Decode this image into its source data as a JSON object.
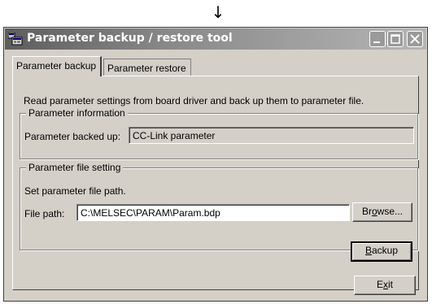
{
  "arrow": "↓",
  "window": {
    "title": "Parameter backup / restore tool",
    "icons": {
      "app": "app-window-icon",
      "minimize": "minimize-icon",
      "maximize": "maximize-icon",
      "close": "close-icon"
    }
  },
  "tabs": [
    {
      "label": "Parameter backup",
      "active": true
    },
    {
      "label": "Parameter restore",
      "active": false
    }
  ],
  "description": "Read parameter settings from board driver and back up them to parameter file.",
  "parameter_information": {
    "legend": "Parameter information",
    "label": "Parameter backed up:",
    "value": "CC-Link parameter"
  },
  "parameter_file_setting": {
    "legend": "Parameter file setting",
    "instruction": "Set parameter file path.",
    "path_label": "File path:",
    "path_value": "C:\\MELSEC\\PARAM\\Param.bdp",
    "browse_prefix": "Br",
    "browse_accel": "o",
    "browse_suffix": "wse..."
  },
  "backup_button": {
    "prefix": "",
    "accel": "B",
    "suffix": "ackup"
  },
  "exit_button": {
    "prefix": "E",
    "accel": "x",
    "suffix": "it"
  }
}
